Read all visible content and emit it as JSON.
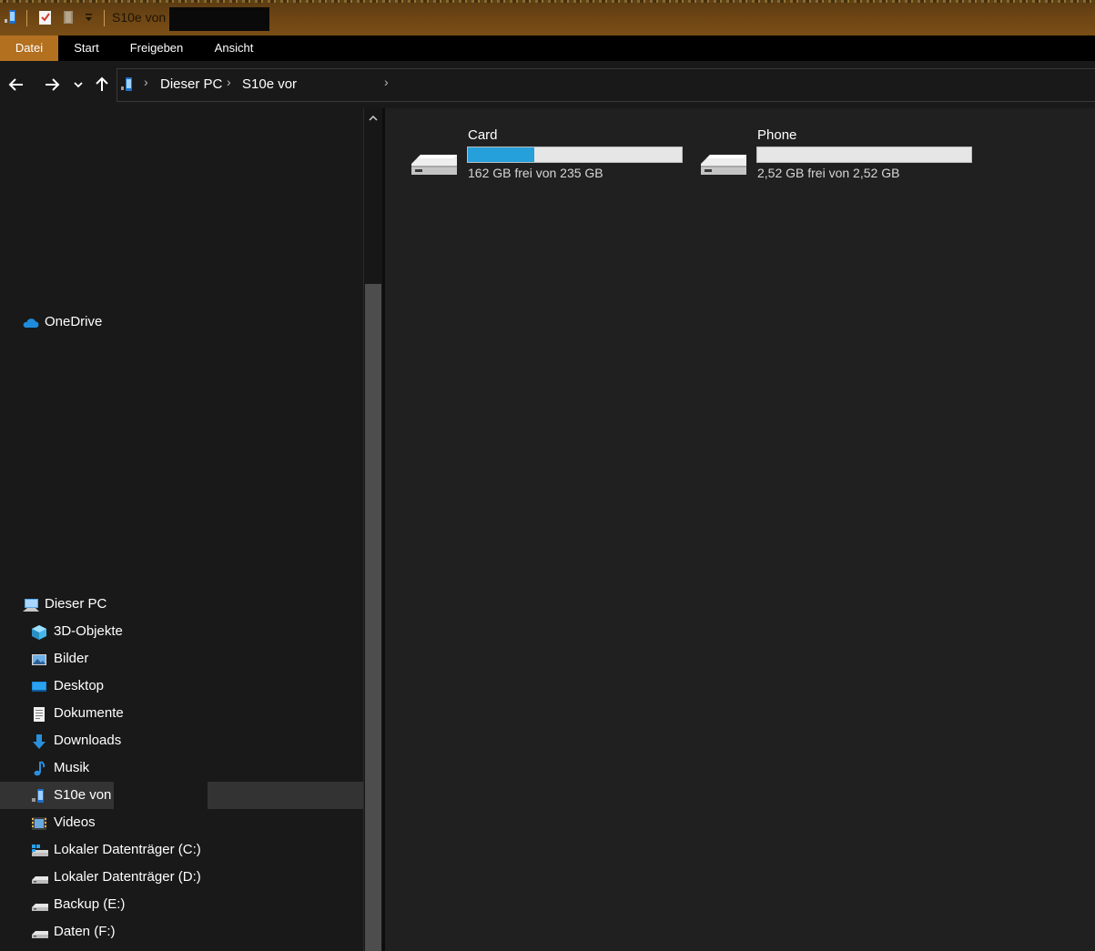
{
  "window": {
    "title": "S10e von"
  },
  "ribbon": {
    "tabs": [
      {
        "label": "Datei",
        "active": true
      },
      {
        "label": "Start",
        "active": false
      },
      {
        "label": "Freigeben",
        "active": false
      },
      {
        "label": "Ansicht",
        "active": false
      }
    ]
  },
  "address_bar": {
    "breadcrumbs": [
      "Dieser PC",
      "S10e vor"
    ]
  },
  "sidebar": {
    "onedrive": {
      "label": "OneDrive",
      "icon": "onedrive-cloud-icon"
    },
    "this_pc": {
      "label": "Dieser PC",
      "icon": "computer-icon"
    },
    "items": [
      {
        "label": "3D-Objekte",
        "icon": "3d-objects-icon"
      },
      {
        "label": "Bilder",
        "icon": "pictures-icon"
      },
      {
        "label": "Desktop",
        "icon": "desktop-icon"
      },
      {
        "label": "Dokumente",
        "icon": "documents-icon"
      },
      {
        "label": "Downloads",
        "icon": "downloads-icon"
      },
      {
        "label": "Musik",
        "icon": "music-icon"
      },
      {
        "label": "S10e von",
        "icon": "phone-device-icon",
        "selected": true
      },
      {
        "label": "Videos",
        "icon": "videos-icon"
      },
      {
        "label": "Lokaler Datenträger (C:)",
        "icon": "system-drive-icon"
      },
      {
        "label": "Lokaler Datenträger (D:)",
        "icon": "drive-icon"
      },
      {
        "label": "Backup (E:)",
        "icon": "drive-icon"
      },
      {
        "label": "Daten (F:)",
        "icon": "drive-icon"
      }
    ]
  },
  "main": {
    "drives": [
      {
        "name": "Card",
        "info": "162 GB frei von 235 GB",
        "used_fraction": 0.31
      },
      {
        "name": "Phone",
        "info": "2,52 GB frei von 2,52 GB",
        "used_fraction": 0.0
      }
    ]
  },
  "colors": {
    "accent_tab": "#b3701f",
    "bar_fill": "#26a0da",
    "background": "#191919"
  }
}
